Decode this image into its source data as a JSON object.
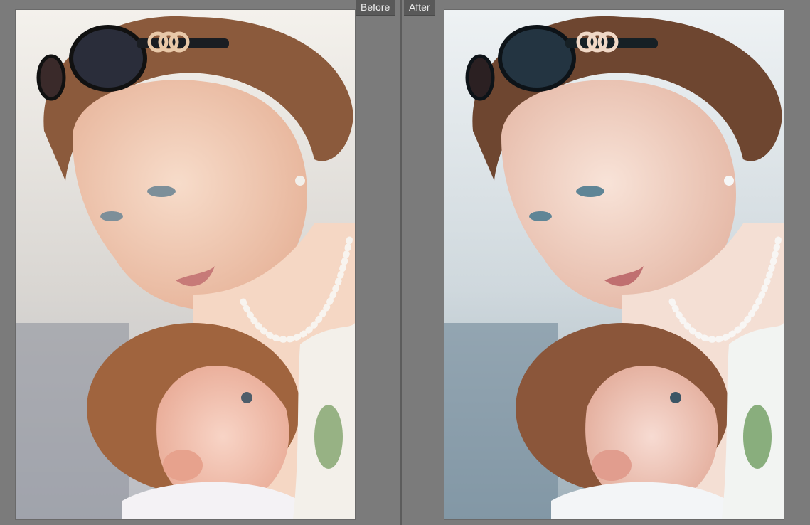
{
  "compare_view": {
    "before_label": "Before",
    "after_label": "After"
  },
  "palette": {
    "background": "#7b7b7b",
    "label_bg": "#595959",
    "label_text": "#ececec",
    "before_tone": "#f0dccb",
    "after_tone": "#e8eef2"
  }
}
